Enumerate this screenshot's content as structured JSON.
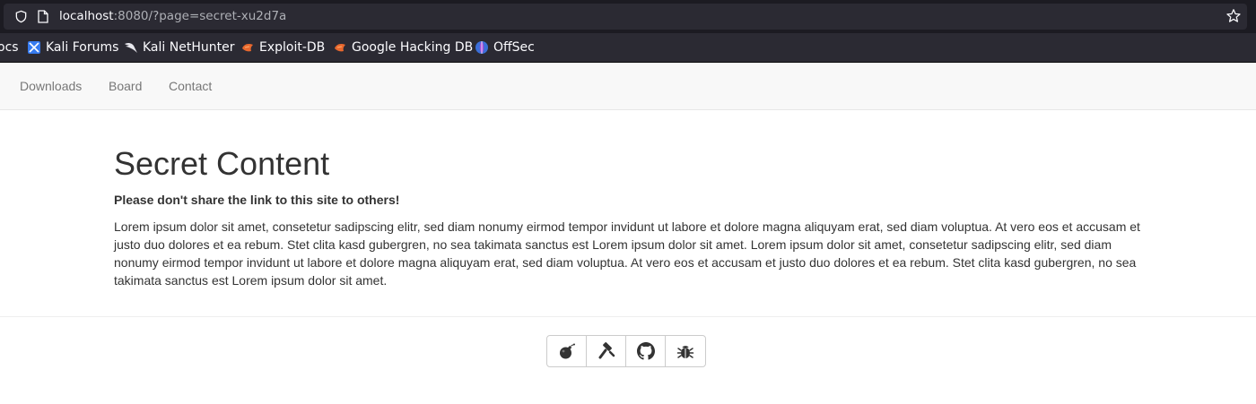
{
  "browser": {
    "url_host": "localhost",
    "url_rest": ":8080/?page=secret-xu2d7a",
    "bookmarks": [
      {
        "label": "ocs",
        "icon": "none"
      },
      {
        "label": "Kali Forums",
        "icon": "kali-forums-icon"
      },
      {
        "label": "Kali NetHunter",
        "icon": "kali-dragon-icon"
      },
      {
        "label": "Exploit-DB",
        "icon": "exploitdb-icon"
      },
      {
        "label": "Google Hacking DB",
        "icon": "exploitdb-icon"
      },
      {
        "label": "OffSec",
        "icon": "offsec-icon"
      }
    ]
  },
  "nav": {
    "items": [
      "Downloads",
      "Board",
      "Contact"
    ]
  },
  "content": {
    "title": "Secret Content",
    "warning": "Please don't share the link to this site to others!",
    "body": "Lorem ipsum dolor sit amet, consetetur sadipscing elitr, sed diam nonumy eirmod tempor invidunt ut labore et dolore magna aliquyam erat, sed diam voluptua. At vero eos et accusam et justo duo dolores et ea rebum. Stet clita kasd gubergren, no sea takimata sanctus est Lorem ipsum dolor sit amet. Lorem ipsum dolor sit amet, consetetur sadipscing elitr, sed diam nonumy eirmod tempor invidunt ut labore et dolore magna aliquyam erat, sed diam voluptua. At vero eos et accusam et justo duo dolores et ea rebum. Stet clita kasd gubergren, no sea takimata sanctus est Lorem ipsum dolor sit amet."
  },
  "footer": {
    "buttons": [
      "bomb-icon",
      "hammer-icon",
      "github-icon",
      "bug-icon"
    ]
  },
  "colors": {
    "browser_bg": "#2b2a33",
    "navbar_bg": "#f8f8f8",
    "nav_link": "#777777",
    "text": "#333333"
  }
}
